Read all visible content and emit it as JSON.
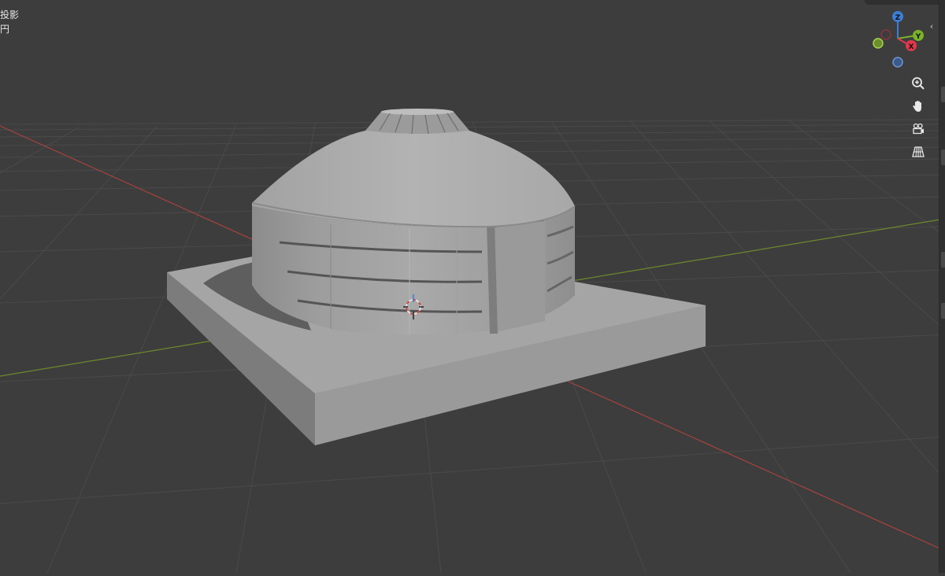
{
  "viewport": {
    "overlay_info": {
      "line1": "投影",
      "line2": "円"
    },
    "nav_gizmo": {
      "axes": [
        {
          "label": "Z",
          "color": "#3b7ed6"
        },
        {
          "label": "Y",
          "color": "#7ab32a"
        },
        {
          "label": "X",
          "color": "#e0394b"
        }
      ],
      "negative_colors": {
        "x": "#8a3340",
        "y": "#6b8f2a",
        "z": "#3b5b8c"
      }
    },
    "tools": [
      {
        "name": "zoom",
        "icon": "zoom-in-icon"
      },
      {
        "name": "pan",
        "icon": "hand-icon"
      },
      {
        "name": "camera",
        "icon": "camera-icon"
      },
      {
        "name": "perspective",
        "icon": "grid-perspective-icon"
      }
    ],
    "axis_colors": {
      "x_axis": "#a8433d",
      "y_axis": "#6c8a2b",
      "grid": "#4a4a4a"
    }
  }
}
